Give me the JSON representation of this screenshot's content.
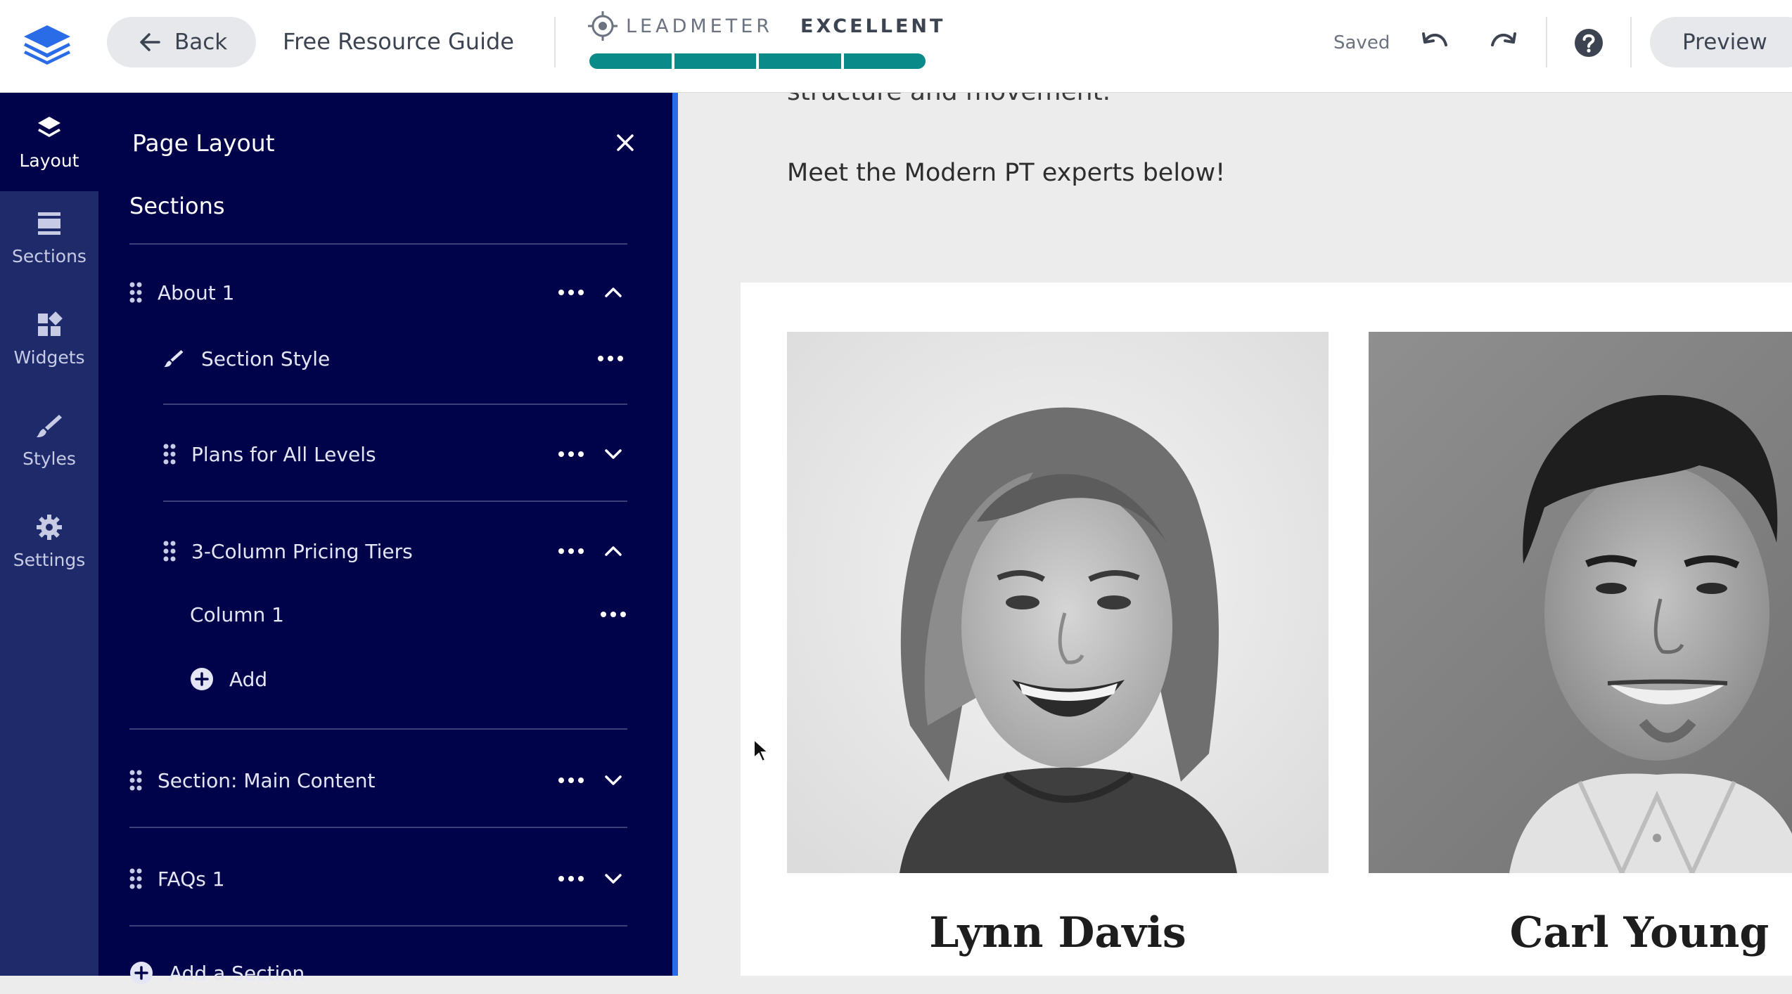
{
  "topbar": {
    "back_label": "Back",
    "page_name": "Free Resource Guide",
    "leadmeter_label": "LEADMETER",
    "leadmeter_score": "EXCELLENT",
    "leadmeter_segments_filled": 4,
    "leadmeter_segments_total": 4,
    "saved_label": "Saved",
    "preview_label": "Preview"
  },
  "rail": {
    "items": [
      {
        "label": "Layout",
        "icon": "layers-icon"
      },
      {
        "label": "Sections",
        "icon": "sections-icon"
      },
      {
        "label": "Widgets",
        "icon": "widgets-icon"
      },
      {
        "label": "Styles",
        "icon": "brush-icon"
      },
      {
        "label": "Settings",
        "icon": "gear-icon"
      }
    ]
  },
  "panel": {
    "title": "Page Layout",
    "sections_heading": "Sections",
    "rows": {
      "about": "About 1",
      "section_style": "Section Style",
      "plans": "Plans for All Levels",
      "pricing": "3-Column Pricing Tiers",
      "column": "Column 1",
      "add": "Add",
      "main_content": "Section: Main Content",
      "faqs": "FAQs 1",
      "add_section": "Add a Section"
    }
  },
  "content": {
    "partial_line": "structure and movement.",
    "intro_line": "Meet the Modern PT experts below!",
    "people": [
      {
        "name": "Lynn Davis"
      },
      {
        "name": "Carl Young"
      }
    ]
  },
  "colors": {
    "panel_bg": "#01034a",
    "rail_bg": "#1f2a6b",
    "accent_blue": "#2a6be8",
    "leadmeter_teal": "#0b8a8a"
  }
}
